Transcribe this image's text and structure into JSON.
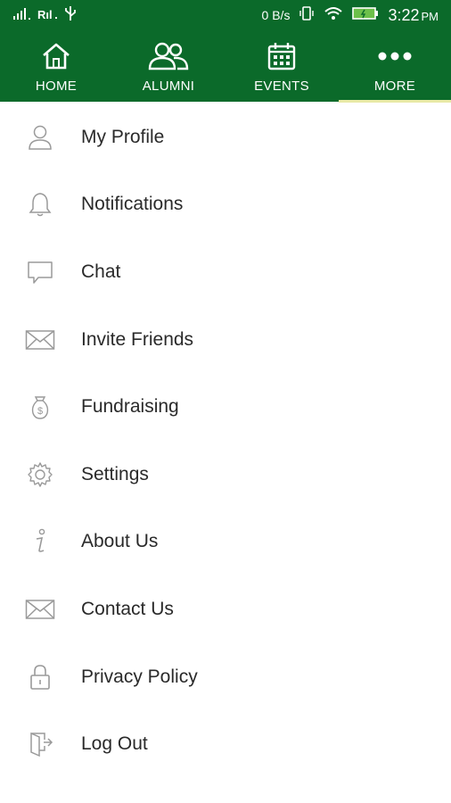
{
  "status_bar": {
    "net_speed": "0 B/s",
    "time": "3:22",
    "ampm": "PM",
    "color": "#0b6a2a"
  },
  "tabs": [
    {
      "label": "HOME",
      "icon": "home-icon"
    },
    {
      "label": "ALUMNI",
      "icon": "alumni-icon"
    },
    {
      "label": "EVENTS",
      "icon": "calendar-icon"
    },
    {
      "label": "MORE",
      "icon": "more-icon",
      "active": true
    }
  ],
  "menu": {
    "items": [
      {
        "label": "My Profile",
        "icon": "profile-icon"
      },
      {
        "label": "Notifications",
        "icon": "bell-icon"
      },
      {
        "label": "Chat",
        "icon": "chat-icon"
      },
      {
        "label": "Invite Friends",
        "icon": "envelope-icon"
      },
      {
        "label": "Fundraising",
        "icon": "fundraising-icon"
      },
      {
        "label": "Settings",
        "icon": "gear-icon"
      },
      {
        "label": "About Us",
        "icon": "info-icon"
      },
      {
        "label": "Contact Us",
        "icon": "envelope-icon"
      },
      {
        "label": "Privacy Policy",
        "icon": "lock-icon"
      },
      {
        "label": "Log Out",
        "icon": "logout-icon"
      }
    ]
  },
  "colors": {
    "brand_green": "#0b6a2a",
    "active_indicator": "#e8e9a6",
    "menu_text": "#2a2a2a",
    "menu_icon": "#9a9a9a"
  }
}
